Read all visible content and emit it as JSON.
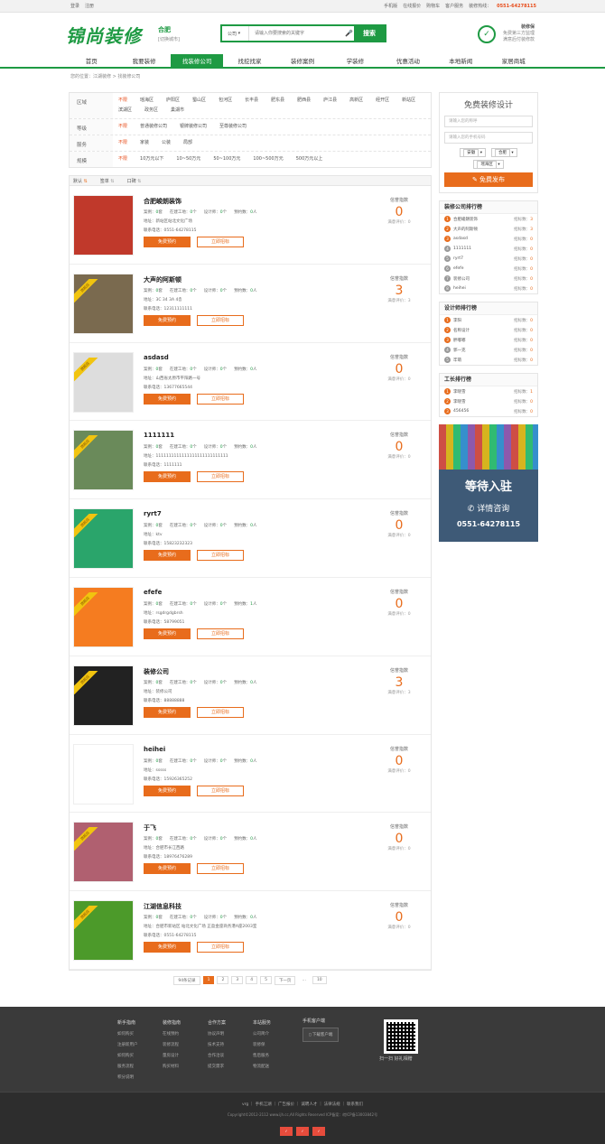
{
  "topbar": {
    "login": "登录",
    "register": "注册",
    "mobile": "手机版",
    "quote": "在线报价",
    "cart": "购物车",
    "service": "客户服务",
    "hotline_label": "装修热线：",
    "hotline": "0551-64278115"
  },
  "header": {
    "logo": "锦尚装修",
    "city": "合肥",
    "city_switch": "[切换城市]",
    "search_select": "公司",
    "search_placeholder": "请输入你要搜索的关键字",
    "search_btn": "搜索",
    "guarantee_title": "装修保",
    "guarantee_l1": "免费第三方监理",
    "guarantee_l2": "满意后付装修款"
  },
  "nav": [
    "首页",
    "我要装修",
    "找装修公司",
    "找挖找家",
    "装修案例",
    "学装修",
    "优惠活动",
    "本地新闻",
    "家居商城"
  ],
  "crumb": "您的位置：江湖装修 > 找装修公司",
  "filters": [
    {
      "key": "区域",
      "vals": [
        "不限",
        "瑶海区",
        "庐阳区",
        "蜀山区",
        "包河区",
        "长丰县",
        "肥东县",
        "肥西县",
        "庐江县",
        "高新区",
        "经开区",
        "新站区",
        "滨湖区",
        "政务区",
        "巢湖市"
      ]
    },
    {
      "key": "等级",
      "vals": [
        "不限",
        "普通装修公司",
        "银牌装修公司",
        "至尊装修公司"
      ]
    },
    {
      "key": "服务",
      "vals": [
        "不限",
        "家装",
        "公装",
        "局部"
      ]
    },
    {
      "key": "规模",
      "vals": [
        "不限",
        "10万元以下",
        "10~50万元",
        "50~100万元",
        "100~500万元",
        "500万元以上"
      ]
    }
  ],
  "sort": [
    "默认",
    "签单",
    "口碑"
  ],
  "companies": [
    {
      "name": "合肥峻朗装饰",
      "case": "0",
      "site": "0",
      "designer": "0",
      "reserve": "0",
      "addr": "地址：新站区站北文化广场",
      "tel": "联系电话：0551-64278115",
      "score_label": "信誉指数",
      "score": "0",
      "count": "满意评价：0",
      "flag": false
    },
    {
      "name": "大声的阿斯顿",
      "case": "0",
      "site": "0",
      "designer": "0",
      "reserve": "0",
      "addr": "地址：3C 34 3A 4층",
      "tel": "联系电话：12311111111",
      "score_label": "信誉指数",
      "score": "3",
      "count": "满意评价：3",
      "flag": true
    },
    {
      "name": "asdasd",
      "case": "0",
      "site": "0",
      "designer": "0",
      "reserve": "0",
      "addr": "地址：山西省太原市平阳路一号",
      "tel": "联系电话：13677665544",
      "score_label": "信誉指数",
      "score": "0",
      "count": "满意评价：0",
      "flag": true
    },
    {
      "name": "1111111",
      "case": "0",
      "site": "0",
      "designer": "0",
      "reserve": "0",
      "addr": "地址：1111111111111111111111111111",
      "tel": "联系电话：1111111",
      "score_label": "信誉指数",
      "score": "0",
      "count": "满意评价：0",
      "flag": true
    },
    {
      "name": "ryrt7",
      "case": "0",
      "site": "0",
      "designer": "0",
      "reserve": "0",
      "addr": "地址：ktv",
      "tel": "联系电话：15823232323",
      "score_label": "信誉指数",
      "score": "0",
      "count": "满意评价：0",
      "flag": true
    },
    {
      "name": "efefe",
      "case": "0",
      "site": "0",
      "designer": "0",
      "reserve": "1",
      "addr": "地址：rsgdrgdgbrsh",
      "tel": "联系电话：58799051",
      "score_label": "信誉指数",
      "score": "0",
      "count": "满意评价：0",
      "flag": true
    },
    {
      "name": "装修公司",
      "case": "0",
      "site": "0",
      "designer": "0",
      "reserve": "0",
      "addr": "地址：装修公司",
      "tel": "联系电话：88888888",
      "score_label": "信誉指数",
      "score": "3",
      "count": "满意评价：3",
      "flag": true
    },
    {
      "name": "heihei",
      "case": "0",
      "site": "0",
      "designer": "0",
      "reserve": "0",
      "addr": "地址：sssss",
      "tel": "联系电话：15926365252",
      "score_label": "信誉指数",
      "score": "0",
      "count": "满意评价：0",
      "flag": false
    },
    {
      "name": "于飞",
      "case": "0",
      "site": "0",
      "designer": "0",
      "reserve": "0",
      "addr": "地址：合肥市长江西路",
      "tel": "联系电话：18976476289",
      "score_label": "信誉指数",
      "score": "0",
      "count": "满意评价：0",
      "flag": true
    },
    {
      "name": "江湖信息科技",
      "case": "0",
      "site": "0",
      "designer": "0",
      "reserve": "0",
      "addr": "地址：合肥市新站区 站北文化广场 正盈金座商务港A座2003室",
      "tel": "联系电话：0551-64278115",
      "score_label": "信誉指数",
      "score": "0",
      "count": "满意评价：0",
      "flag": true
    }
  ],
  "labels": {
    "case": "案例：",
    "site": "在建工地：",
    "designer": "设计师：",
    "reserve": "预约数：",
    "unit_jian": "套",
    "unit_ge": "个",
    "unit_ren": "人",
    "btn_free": "免费预约",
    "btn_bid": "立即招标"
  },
  "pager": {
    "total": "94条记录",
    "pages": [
      "1",
      "2",
      "3",
      "4",
      "5"
    ],
    "next": "下一页",
    "last": "10"
  },
  "sidebar": {
    "form_title": "免费装修设计",
    "name_ph": "请输入您的称呼",
    "phone_ph": "请输入您的手机号码",
    "prov": "安徽",
    "city": "合肥",
    "area": "瑶海区",
    "submit": "免费发布",
    "rank1_title": "装修公司排行榜",
    "rank1": [
      {
        "n": "1",
        "name": "合肥峻朗装饰",
        "s": "3"
      },
      {
        "n": "2",
        "name": "大声的阿斯顿",
        "s": "3"
      },
      {
        "n": "3",
        "name": "asdasd",
        "s": "0"
      },
      {
        "n": "4",
        "name": "1111111",
        "s": "0"
      },
      {
        "n": "5",
        "name": "ryrt7",
        "s": "0"
      },
      {
        "n": "6",
        "name": "efefe",
        "s": "0"
      },
      {
        "n": "7",
        "name": "装修公司",
        "s": "0"
      },
      {
        "n": "8",
        "name": "heihei",
        "s": "0"
      }
    ],
    "rank2_title": "设计师排行榜",
    "rank2": [
      {
        "n": "1",
        "name": "李阳",
        "s": "0"
      },
      {
        "n": "2",
        "name": "名称设计",
        "s": "0"
      },
      {
        "n": "3",
        "name": "胖嘟嘟",
        "s": "0"
      },
      {
        "n": "4",
        "name": "郭一克",
        "s": "0"
      },
      {
        "n": "5",
        "name": "牢萌",
        "s": "0"
      }
    ],
    "rank3_title": "工长排行榜",
    "rank3": [
      {
        "n": "1",
        "name": "李晓雪",
        "s": "1"
      },
      {
        "n": "2",
        "name": "李晓雪",
        "s": "0"
      },
      {
        "n": "3",
        "name": "456456",
        "s": "0"
      }
    ],
    "score_label": "招标数：",
    "ad_t1": "等待入驻",
    "ad_t2": "详情咨询",
    "ad_t3": "0551-64278115"
  },
  "footer": {
    "cols": [
      {
        "title": "新手指南",
        "items": [
          "如何购买",
          "注册新用户",
          "如何购买",
          "服务流程",
          "积分说明"
        ]
      },
      {
        "title": "装修指南",
        "items": [
          "在线预约",
          "装修流程",
          "量房设计",
          "购买材料"
        ]
      },
      {
        "title": "合作方案",
        "items": [
          "协议声明",
          "技术支持",
          "合作洽谈",
          "提交需求"
        ]
      },
      {
        "title": "本站服务",
        "items": [
          "公司简介",
          "装修保",
          "售后服务",
          "物流配送"
        ]
      }
    ],
    "app_title": "手机客户端",
    "app_dl": "下载客户端",
    "qr_label": "扫一扫 好礼相赠",
    "links": "vrg ｜ 手机江湖 ｜ 广告报价 ｜ 诚聘人才 ｜ 法律法规 ｜ 联系我们",
    "copy": "Copyright©2012-2112 www.ijh.cc,All Rights Reserved ICP备案：皖ICP备13003842号"
  }
}
